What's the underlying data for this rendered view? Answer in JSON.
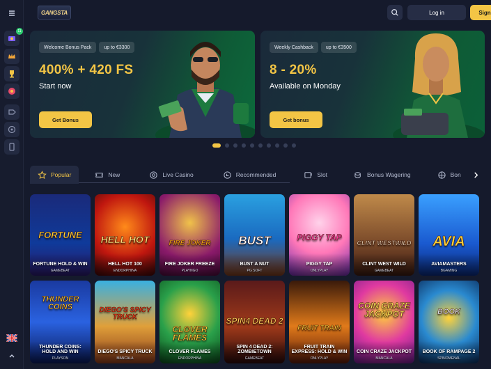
{
  "topbar": {
    "login_label": "Log in",
    "signup_label": "Sign up",
    "logo_text": "GANGSTA"
  },
  "banners": [
    {
      "tag1": "Welcome Bonus Pack",
      "tag2": "up to €3300",
      "headline": "400% + 420 FS",
      "subline": "Start now",
      "cta": "Get Bonus"
    },
    {
      "tag1": "Weekly Cashback",
      "tag2": "up to €3500",
      "headline": "8 - 20%",
      "subline": "Available on Monday",
      "cta": "Get bonus"
    }
  ],
  "carousel": {
    "total_slides": 10,
    "active_slide": 1
  },
  "tabs": [
    {
      "label": "Popular",
      "icon": "star-icon"
    },
    {
      "label": "New",
      "icon": "ticket-icon"
    },
    {
      "label": "Live Casino",
      "icon": "chip-icon"
    },
    {
      "label": "Recommended",
      "icon": "thumbs-icon"
    },
    {
      "label": "Slot",
      "icon": "slot-icon"
    },
    {
      "label": "Bonus Wagering",
      "icon": "coins-icon"
    },
    {
      "label": "Bon",
      "icon": "spin-icon"
    }
  ],
  "sidebar": {
    "badge": "11",
    "language": "en-gb-flag-icon"
  },
  "games": [
    {
      "name": "FORTUNE HOLD & WIN",
      "provider": "GAMEBEAT",
      "art": "FORTUNE"
    },
    {
      "name": "HELL HOT 100",
      "provider": "ENDORPHINA",
      "art": "HELL HOT"
    },
    {
      "name": "FIRE JOKER FREEZE",
      "provider": "PLAYNGO",
      "art": "FIRE JOKER"
    },
    {
      "name": "BUST A NUT",
      "provider": "PG SOFT",
      "art": "BUST"
    },
    {
      "name": "PIGGY TAP",
      "provider": "ONLYPLAY",
      "art": "PIGGY TAP"
    },
    {
      "name": "CLINT WEST WILD",
      "provider": "GAMEBEAT",
      "art": "CLINT WESTWILD"
    },
    {
      "name": "AVIAMASTERS",
      "provider": "BGAMING",
      "art": "AVIA"
    },
    {
      "name": "THUNDER COINS: HOLD AND WIN",
      "provider": "PLAYSON",
      "art": "THUNDER COINS"
    },
    {
      "name": "DIEGO'S SPICY TRUCK",
      "provider": "MANCALA",
      "art": "DIEGO'S SPICY TRUCK"
    },
    {
      "name": "CLOVER FLAMES",
      "provider": "ENDORPHINA",
      "art": "CLOVER FLAMES"
    },
    {
      "name": "SPIN 4 DEAD 2: ZOMBIETOWN",
      "provider": "GAMEBEAT",
      "art": "SPIN4 DEAD 2"
    },
    {
      "name": "FRUIT TRAIN EXPRESS: HOLD & WIN",
      "provider": "ONLYPLAY",
      "art": "FRUIT TRAIN"
    },
    {
      "name": "COIN CRAZE JACKPOT",
      "provider": "MANCALA",
      "art": "COIN CRAZE JACKPOT"
    },
    {
      "name": "BOOK OF RAMPAGE 2",
      "provider": "SPINOMENAL",
      "art": "BOOK"
    }
  ],
  "colors": {
    "accent": "#f3c545",
    "background": "#151a2c",
    "panel": "#232a41"
  }
}
